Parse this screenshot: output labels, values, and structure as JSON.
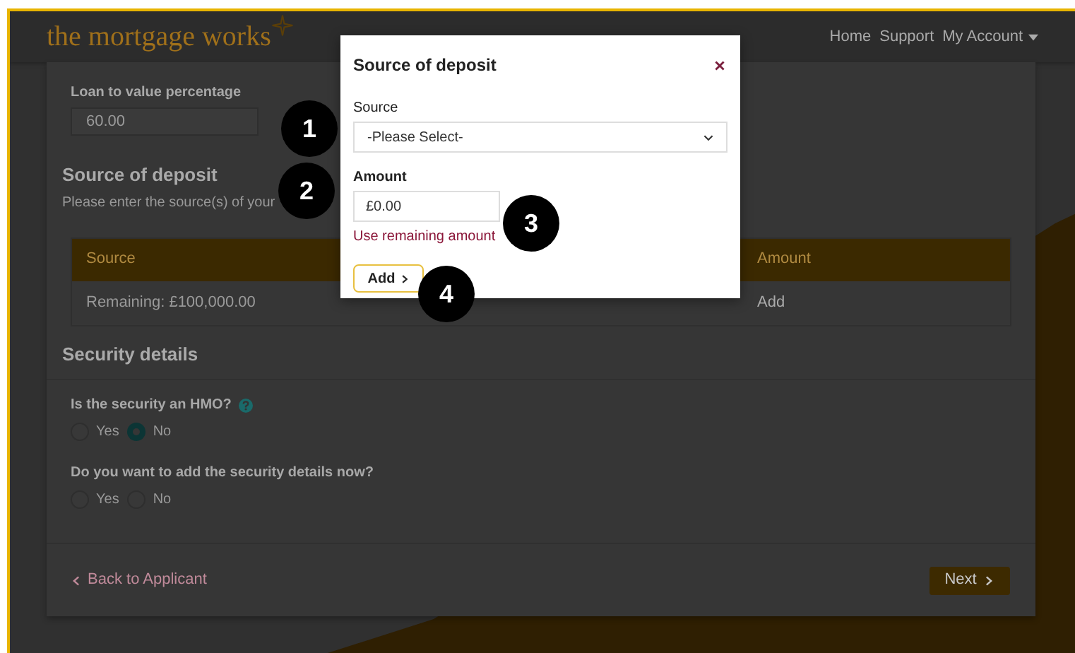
{
  "header": {
    "logo": "the mortgage works",
    "nav": [
      {
        "label": "Home",
        "dropdown": false
      },
      {
        "label": "Support",
        "dropdown": false
      },
      {
        "label": "My Account",
        "dropdown": true
      }
    ]
  },
  "ltv": {
    "label": "Loan to value percentage",
    "value": "60.00"
  },
  "deposit": {
    "title": "Source of deposit",
    "description": "Please enter the source(s) of your",
    "columns": [
      "Source",
      "Amount"
    ],
    "rows": [
      {
        "source": "Remaining: £100,000.00",
        "amount": "Add"
      }
    ]
  },
  "security": {
    "title": "Security details",
    "questions": [
      {
        "label": "Is the security an HMO?",
        "help": true,
        "options": [
          {
            "label": "Yes",
            "selected": false
          },
          {
            "label": "No",
            "selected": true
          }
        ]
      },
      {
        "label": "Do you want to add the security details now?",
        "help": false,
        "options": [
          {
            "label": "Yes",
            "selected": false
          },
          {
            "label": "No",
            "selected": false
          }
        ]
      }
    ]
  },
  "footer": {
    "back": "Back to Applicant",
    "next": "Next"
  },
  "modal": {
    "title": "Source of deposit",
    "source_label": "Source",
    "source_value": "-Please Select-",
    "amount_label": "Amount",
    "amount_value": "£0.00",
    "remaining_link": "Use remaining amount",
    "add_button": "Add"
  },
  "callouts": [
    "1",
    "2",
    "3",
    "4"
  ]
}
